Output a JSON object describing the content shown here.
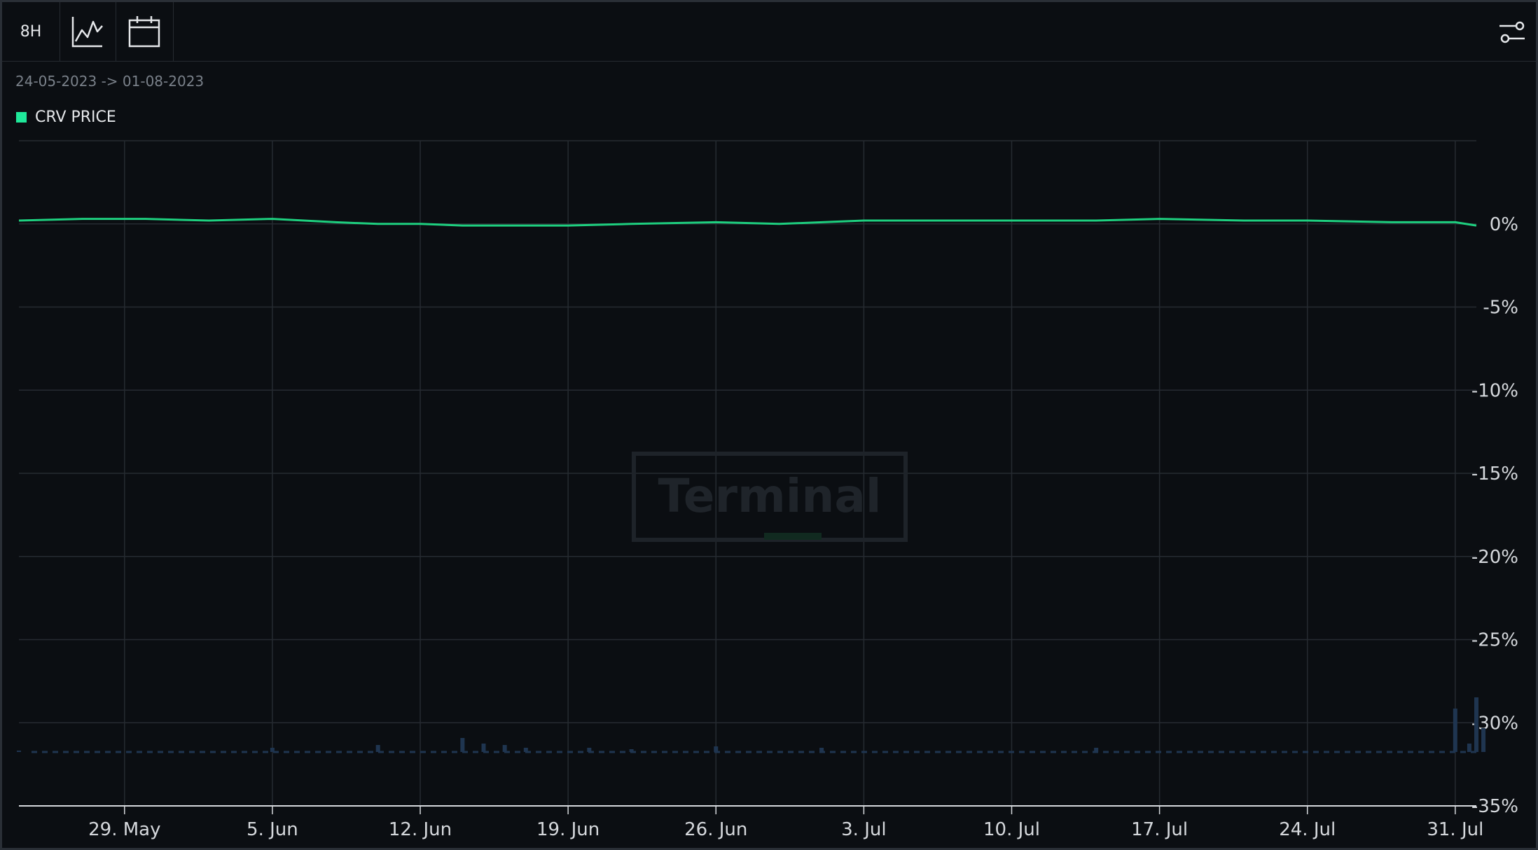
{
  "toolbar": {
    "interval_label": "8H",
    "chart_icon": "line-chart-icon",
    "calendar_icon": "calendar-icon",
    "settings_icon": "sliders-icon"
  },
  "date_range": "24-05-2023 -> 01-08-2023",
  "watermark": "Terminal",
  "colors": {
    "price_line": "#1ecf7f",
    "legend_swatch": "#1fe89a",
    "volume_bar": "#1f3550",
    "grid": "#262b31",
    "axis_text": "#d6d9dd",
    "background": "#0b0e12"
  },
  "chart_data": {
    "type": "line",
    "title": "",
    "xlabel": "",
    "ylabel": "",
    "x_ticks": [
      "29. May",
      "5. Jun",
      "12. Jun",
      "19. Jun",
      "26. Jun",
      "3. Jul",
      "10. Jul",
      "17. Jul",
      "24. Jul",
      "31. Jul"
    ],
    "x_tick_dates": [
      "2023-05-29",
      "2023-06-05",
      "2023-06-12",
      "2023-06-19",
      "2023-06-26",
      "2023-07-03",
      "2023-07-10",
      "2023-07-17",
      "2023-07-24",
      "2023-07-31"
    ],
    "x_range": [
      "2023-05-24",
      "2023-08-01"
    ],
    "y_ticks": [
      "0%",
      "-5%",
      "-10%",
      "-15%",
      "-20%",
      "-25%",
      "-30%",
      "-35%"
    ],
    "y_tick_values": [
      0,
      -5,
      -10,
      -15,
      -20,
      -25,
      -30,
      -35
    ],
    "ylim": [
      -35,
      5
    ],
    "grid": true,
    "legend_position": "top-left",
    "series": [
      {
        "name": "CRV PRICE",
        "x": [
          "2023-05-24",
          "2023-05-27",
          "2023-05-30",
          "2023-06-02",
          "2023-06-05",
          "2023-06-08",
          "2023-06-10",
          "2023-06-12",
          "2023-06-14",
          "2023-06-16",
          "2023-06-19",
          "2023-06-22",
          "2023-06-26",
          "2023-06-29",
          "2023-07-03",
          "2023-07-06",
          "2023-07-10",
          "2023-07-14",
          "2023-07-17",
          "2023-07-21",
          "2023-07-24",
          "2023-07-28",
          "2023-07-31",
          "2023-08-01"
        ],
        "y": [
          0.2,
          0.3,
          0.3,
          0.2,
          0.3,
          0.1,
          0.0,
          0.0,
          -0.1,
          -0.1,
          -0.1,
          0.0,
          0.1,
          0.0,
          0.2,
          0.2,
          0.2,
          0.2,
          0.3,
          0.2,
          0.2,
          0.1,
          0.1,
          -0.1
        ]
      }
    ],
    "volume": {
      "x": [
        "2023-05-24",
        "2023-06-05",
        "2023-06-10",
        "2023-06-14",
        "2023-06-15",
        "2023-06-16",
        "2023-06-17",
        "2023-06-20",
        "2023-06-22",
        "2023-06-26",
        "2023-07-01",
        "2023-07-14",
        "2023-07-31",
        "2023-07-31T16",
        "2023-08-01",
        "2023-08-01T08"
      ],
      "relative": [
        0.05,
        0.15,
        0.25,
        0.5,
        0.3,
        0.25,
        0.15,
        0.15,
        0.1,
        0.2,
        0.15,
        0.15,
        1.55,
        0.3,
        1.95,
        0.85
      ]
    }
  }
}
